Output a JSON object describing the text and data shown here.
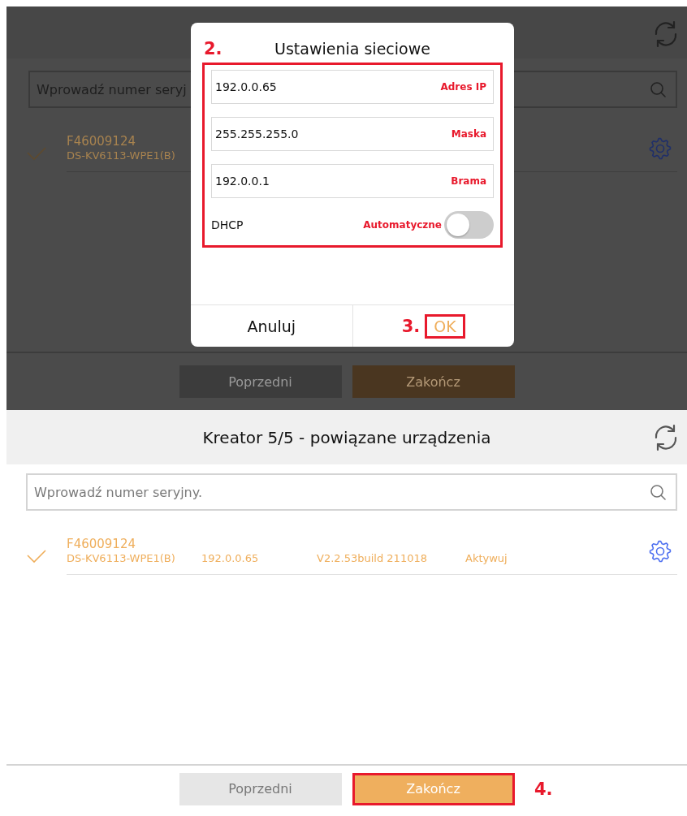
{
  "background_screen": {
    "search": {
      "placeholder": "Wprowadź numer seryj"
    },
    "devices": [
      {
        "serial": "F46009124",
        "model": "DS-KV6113-WPE1(B)",
        "checked": true
      }
    ],
    "buttons": [
      {
        "label": "Poprzedni",
        "kind": "secondary"
      },
      {
        "label": "Zakończ",
        "kind": "primary"
      }
    ]
  },
  "dialog": {
    "title": "Ustawienia sieciowe",
    "step": "2.",
    "fields": [
      {
        "value": "192.0.0.65",
        "label": "Adres IP"
      },
      {
        "value": "255.255.255.0",
        "label": "Maska"
      },
      {
        "value": "192.0.0.1",
        "label": "Brama"
      }
    ],
    "dhcp": {
      "label": "DHCP",
      "option_label": "Automatyczne",
      "on": false
    },
    "buttons": [
      {
        "label": "Anuluj",
        "kind": "cancel"
      },
      {
        "label": "OK",
        "kind": "confirm",
        "step": "3."
      }
    ]
  },
  "wizard_screen": {
    "title": "Kreator 5/5 - powiązane urządzenia",
    "search": {
      "placeholder": "Wprowadź numer seryjny."
    },
    "devices": [
      {
        "serial": "F46009124",
        "model": "DS-KV6113-WPE1(B)",
        "ip": "192.0.0.65",
        "firmware": "V2.2.53build 211018",
        "action": "Aktywuj",
        "checked": true
      }
    ],
    "buttons": [
      {
        "label": "Poprzedni",
        "kind": "secondary"
      },
      {
        "label": "Zakończ",
        "kind": "primary",
        "step": "4."
      }
    ]
  }
}
